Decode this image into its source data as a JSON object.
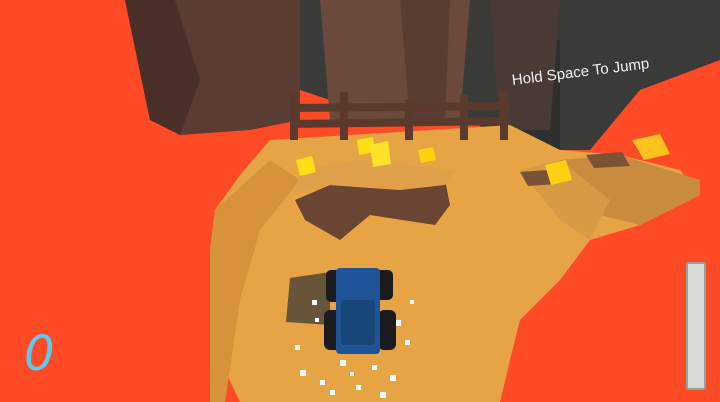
{
  "hud": {
    "score": "0",
    "hint": "Hold Space To Jump",
    "jump_charge_fraction": 0
  },
  "colors": {
    "lava": "#ff4a26",
    "platform": "#e6a444",
    "tree_trunk": "#5a3c33",
    "cube": "#ffde14",
    "car_body": "#1f5597",
    "score_text": "#5fc8ef"
  }
}
